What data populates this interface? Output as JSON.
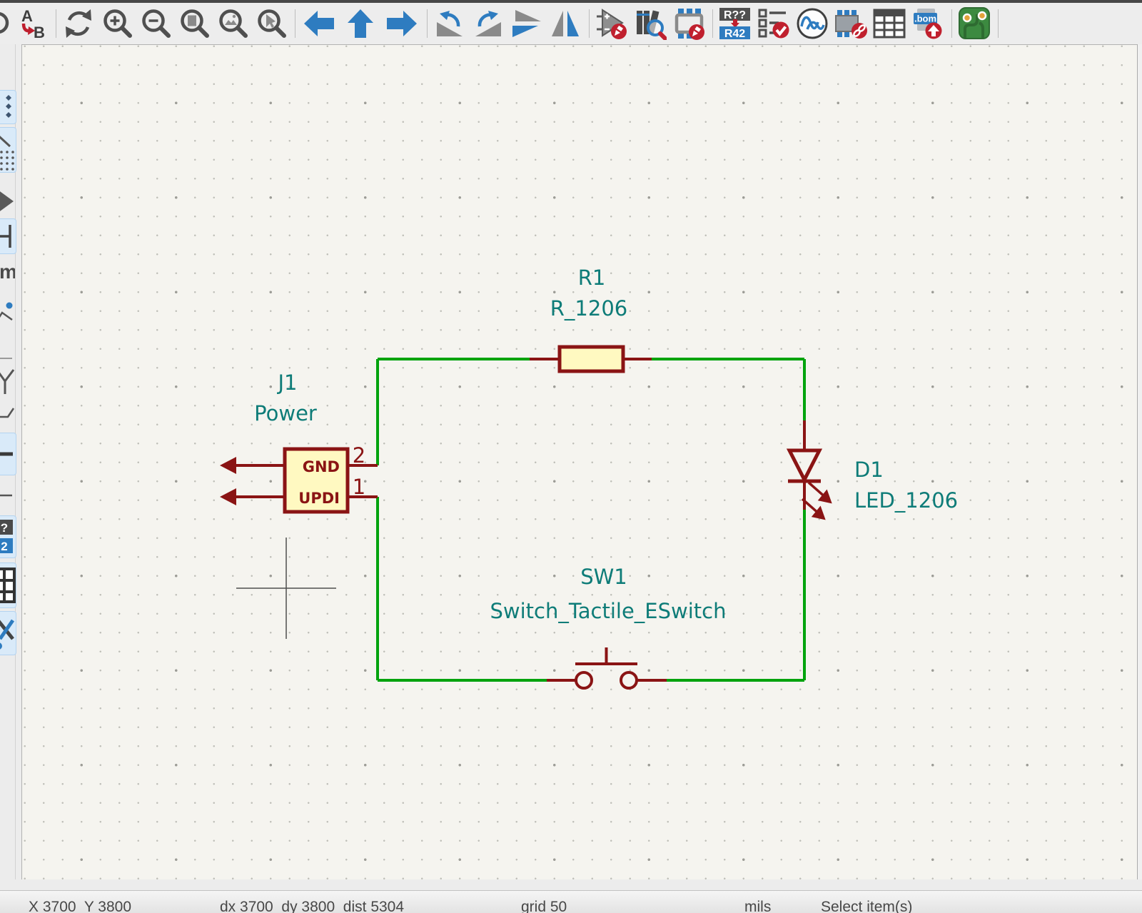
{
  "toolbar": {
    "find_replace": {
      "a": "A",
      "b": "B"
    },
    "annotate": {
      "top": "R??",
      "bottom": "R42"
    },
    "bom_label": ".bom",
    "icons": [
      "find-replace",
      "refresh-view",
      "zoom-in",
      "zoom-out",
      "zoom-to-fit",
      "zoom-to-selection",
      "zoom-to-objects",
      "navigate-left",
      "navigate-up",
      "navigate-right",
      "rotate-ccw",
      "rotate-cw",
      "mirror-vertically",
      "mirror-horizontally",
      "symbol-editor",
      "symbol-library-browser",
      "footprint-editor",
      "annotate-schematic",
      "run-erc",
      "simulator",
      "assign-footprints",
      "symbol-fields-table",
      "export-bom",
      "open-pcb-editor"
    ],
    "colors": {
      "icon_grey": "#4F4F4F",
      "icon_blue": "#2E7CC0",
      "badge_red": "#C0202E"
    }
  },
  "left_toolbar": {
    "badge": {
      "top": "?",
      "bottom": "2"
    }
  },
  "schematic": {
    "j1": {
      "ref": "J1",
      "value": "Power",
      "pin_gnd": "GND",
      "pin_updi": "UPDI",
      "num_gnd": "2",
      "num_updi": "1"
    },
    "r1": {
      "ref": "R1",
      "value": "R_1206"
    },
    "d1": {
      "ref": "D1",
      "value": "LED_1206"
    },
    "sw1": {
      "ref": "SW1",
      "value": "Switch_Tactile_ESwitch"
    },
    "colors": {
      "wire": "#00A30D",
      "outline": "#8A1414",
      "body_fill": "#FFF9C1",
      "fields": "#0E7C78"
    }
  },
  "statusbar": {
    "position": "X 3700  Y 3800",
    "deltas": "dx 3700  dy 3800  dist 5304",
    "grid": "grid 50",
    "units": "mils",
    "action": "Select item(s)"
  }
}
